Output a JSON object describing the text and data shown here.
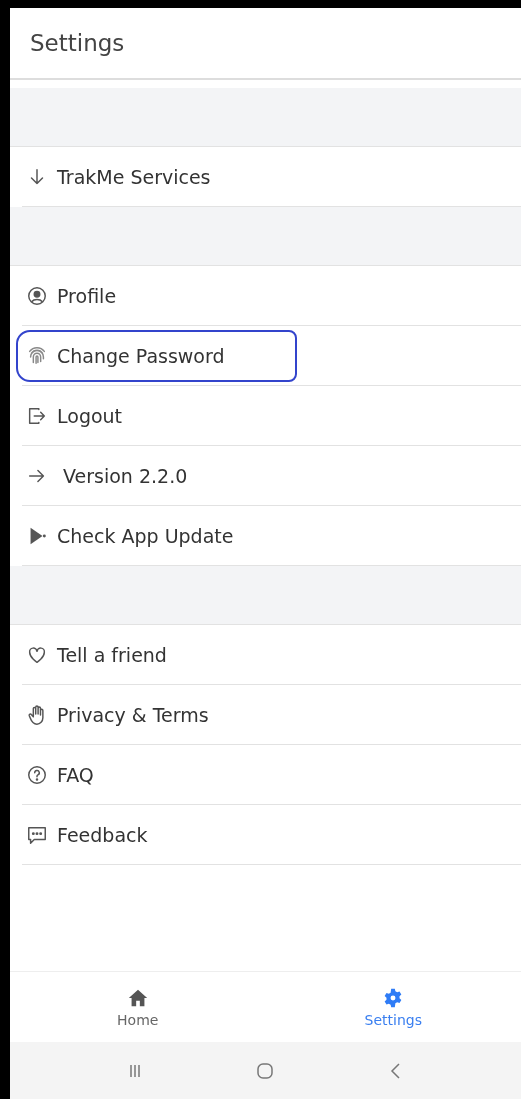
{
  "header": {
    "title": "Settings"
  },
  "sections": [
    {
      "items": [
        {
          "kind": "arrow-down",
          "label": "TrakMe Services",
          "highlighted": false
        }
      ]
    },
    {
      "items": [
        {
          "kind": "profile",
          "label": "Profile",
          "highlighted": false
        },
        {
          "kind": "fingerprint",
          "label": "Change Password",
          "highlighted": true
        },
        {
          "kind": "logout",
          "label": "Logout",
          "highlighted": false
        },
        {
          "kind": "arrow-right",
          "label": " Version 2.2.0",
          "highlighted": false
        },
        {
          "kind": "play",
          "label": "Check App Update",
          "highlighted": false
        }
      ]
    },
    {
      "items": [
        {
          "kind": "heart",
          "label": "Tell a friend",
          "highlighted": false
        },
        {
          "kind": "hand",
          "label": "Privacy & Terms",
          "highlighted": false
        },
        {
          "kind": "help",
          "label": "FAQ",
          "highlighted": false
        },
        {
          "kind": "chat",
          "label": "Feedback",
          "highlighted": false
        }
      ]
    }
  ],
  "bottom_nav": [
    {
      "kind": "home",
      "label": "Home",
      "selected": false
    },
    {
      "kind": "gear",
      "label": "Settings",
      "selected": true
    }
  ],
  "system_nav": [
    {
      "kind": "recents"
    },
    {
      "kind": "home"
    },
    {
      "kind": "back"
    }
  ]
}
